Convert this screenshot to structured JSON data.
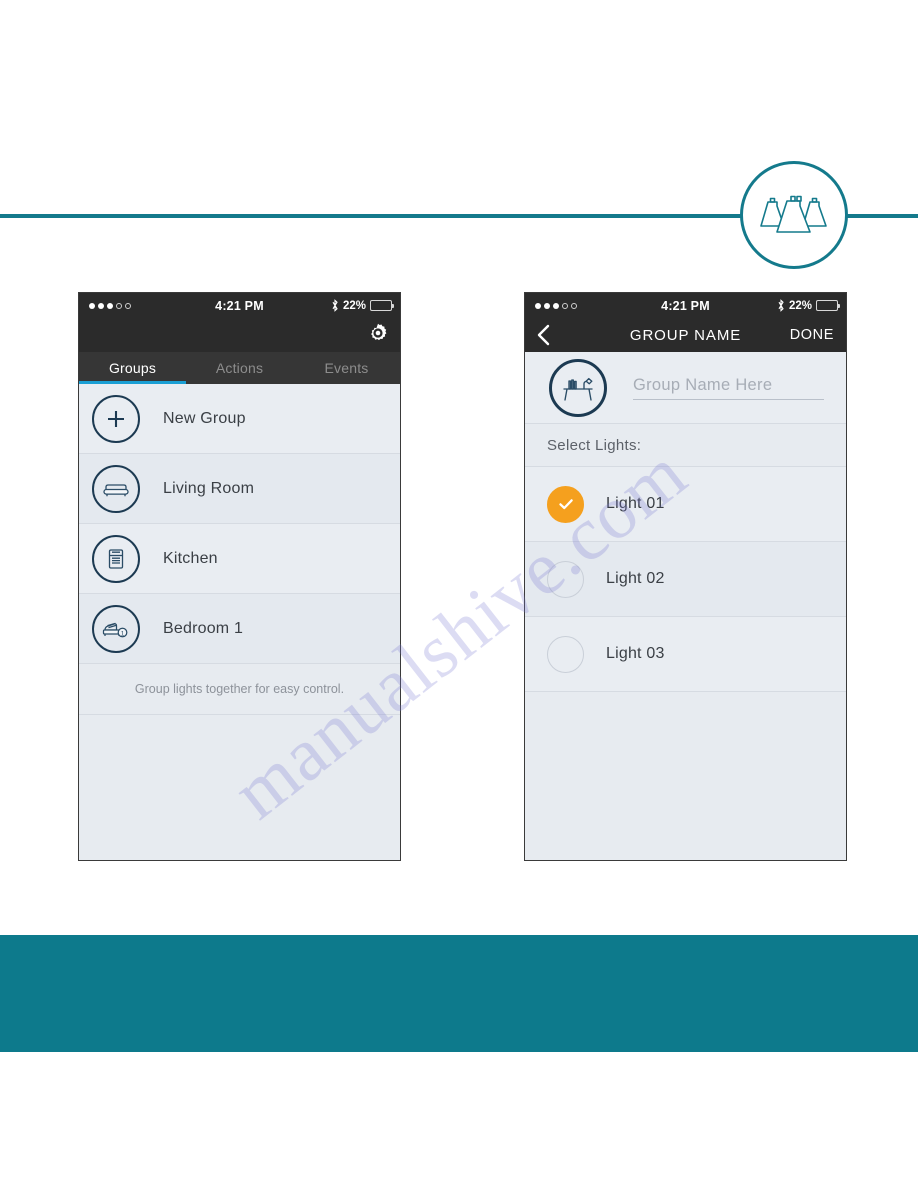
{
  "brand": {
    "logo_icon": "three-lampshades-icon",
    "accent_teal": "#147a8c",
    "footer_band_color": "#0d7a8c"
  },
  "watermark": {
    "text": "manualshive.com"
  },
  "phone_left": {
    "status_bar": {
      "signal_dots_filled": 3,
      "signal_dots_empty": 2,
      "time": "4:21 PM",
      "bluetooth_icon": "bluetooth-icon",
      "battery_percent": "22%",
      "battery_icon": "battery-icon"
    },
    "navbar": {
      "settings_icon": "gear-icon"
    },
    "tabs": [
      {
        "label": "Groups",
        "active": true
      },
      {
        "label": "Actions",
        "active": false
      },
      {
        "label": "Events",
        "active": false
      }
    ],
    "groups": [
      {
        "label": "New Group",
        "icon": "plus-icon"
      },
      {
        "label": "Living Room",
        "icon": "sofa-icon"
      },
      {
        "label": "Kitchen",
        "icon": "fridge-icon"
      },
      {
        "label": "Bedroom 1",
        "icon": "bed-1-icon"
      }
    ],
    "hint": "Group lights together for easy control."
  },
  "phone_right": {
    "status_bar": {
      "signal_dots_filled": 3,
      "signal_dots_empty": 2,
      "time": "4:21 PM",
      "bluetooth_icon": "bluetooth-icon",
      "battery_percent": "22%",
      "battery_icon": "battery-icon"
    },
    "navbar": {
      "back_icon": "chevron-left-icon",
      "title": "GROUP NAME",
      "done_label": "DONE"
    },
    "group_name_field": {
      "icon": "desk-lamp-icon",
      "placeholder": "Group Name Here",
      "value": ""
    },
    "section_label": "Select Lights:",
    "lights": [
      {
        "label": "Light 01",
        "selected": true
      },
      {
        "label": "Light 02",
        "selected": false
      },
      {
        "label": "Light 03",
        "selected": false
      }
    ],
    "check_on_color": "#f5a01e"
  }
}
